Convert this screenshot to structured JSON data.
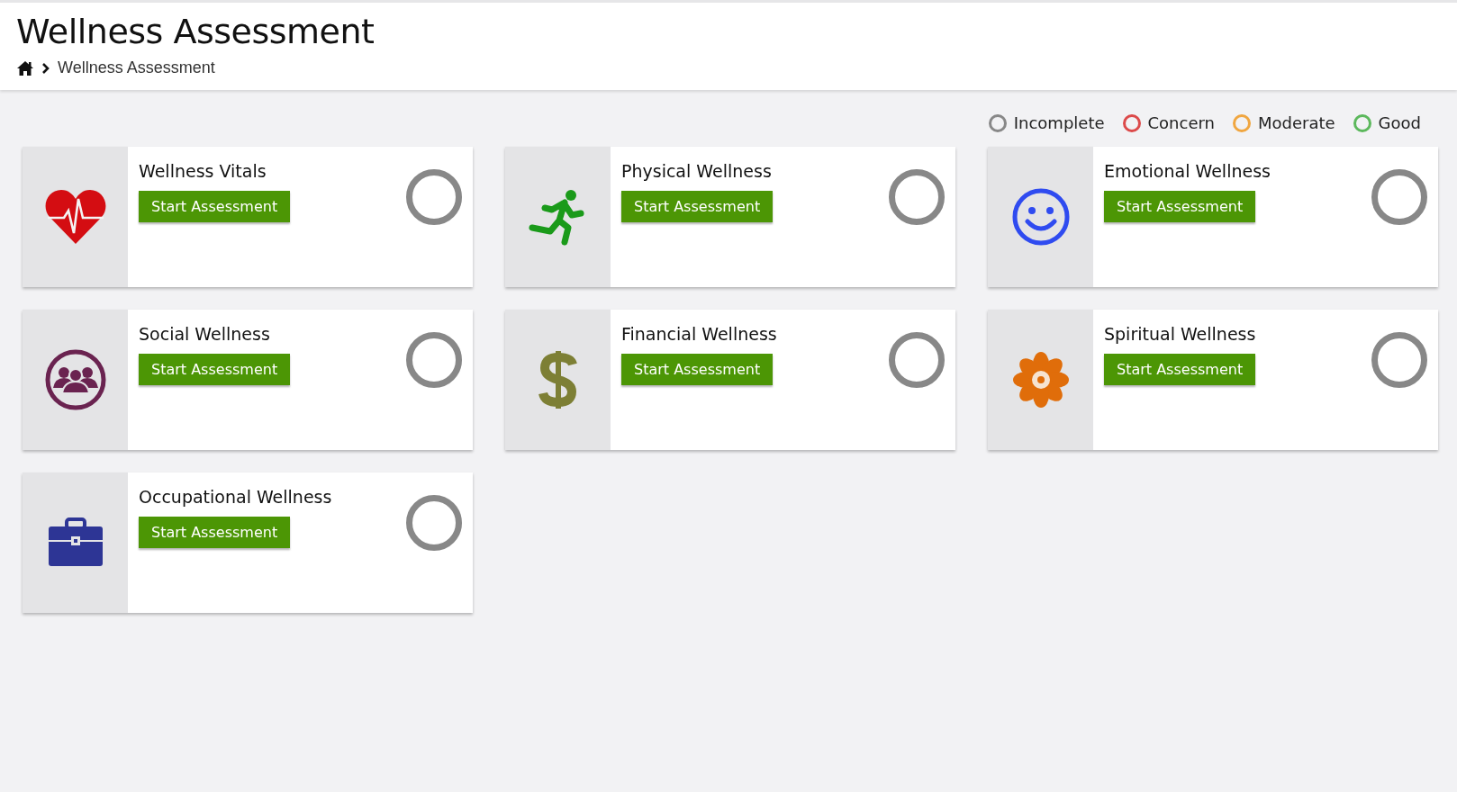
{
  "header": {
    "title": "Wellness Assessment",
    "breadcrumb": [
      "Wellness Assessment"
    ]
  },
  "legend": [
    {
      "label": "Incomplete",
      "color": "#888888"
    },
    {
      "label": "Concern",
      "color": "#dc4a4a"
    },
    {
      "label": "Moderate",
      "color": "#f0a640"
    },
    {
      "label": "Good",
      "color": "#5cb85c"
    }
  ],
  "cards": [
    {
      "kind": "vitals",
      "title": "Wellness Vitals",
      "button": "Start Assessment",
      "color": "#888888"
    },
    {
      "kind": "physical",
      "title": "Physical Wellness",
      "button": "Start Assessment",
      "color": "#888888"
    },
    {
      "kind": "emotional",
      "title": "Emotional Wellness",
      "button": "Start Assessment",
      "color": "#888888"
    },
    {
      "kind": "social",
      "title": "Social Wellness",
      "button": "Start Assessment",
      "color": "#888888"
    },
    {
      "kind": "financial",
      "title": "Financial Wellness",
      "button": "Start Assessment",
      "color": "#888888"
    },
    {
      "kind": "spiritual",
      "title": "Spiritual Wellness",
      "button": "Start Assessment",
      "color": "#888888"
    },
    {
      "kind": "occupational",
      "title": "Occupational Wellness",
      "button": "Start Assessment",
      "color": "#888888"
    }
  ]
}
